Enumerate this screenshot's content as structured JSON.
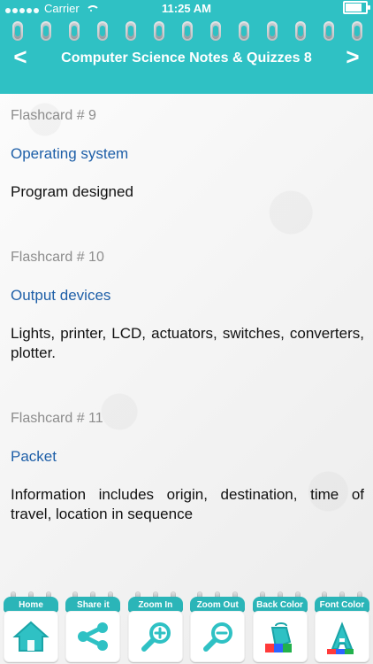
{
  "status_bar": {
    "carrier": "Carrier",
    "time": "11:25 AM"
  },
  "header": {
    "title": "Computer Science Notes & Quizzes 8",
    "left_nav_symbol": "<",
    "right_nav_symbol": ">",
    "accent": "#2fc1c4"
  },
  "cards": [
    {
      "number": "Flashcard # 9",
      "term": "Operating system",
      "definition": "Program designed"
    },
    {
      "number": "Flashcard # 10",
      "term": "Output devices",
      "definition": "Lights, printer, LCD, actuators, switches, converters, plotter."
    },
    {
      "number": "Flashcard # 11",
      "term": "Packet",
      "definition": "Information includes origin, destination, time of travel, location in sequence"
    }
  ],
  "toolbar": {
    "items": [
      {
        "label": "Home",
        "icon": "home-icon"
      },
      {
        "label": "Share it",
        "icon": "share-icon"
      },
      {
        "label": "Zoom In",
        "icon": "zoom-in-icon"
      },
      {
        "label": "Zoom Out",
        "icon": "zoom-out-icon"
      },
      {
        "label": "Back Color",
        "icon": "paint-bucket-icon"
      },
      {
        "label": "Font Color",
        "icon": "font-color-icon"
      }
    ]
  }
}
